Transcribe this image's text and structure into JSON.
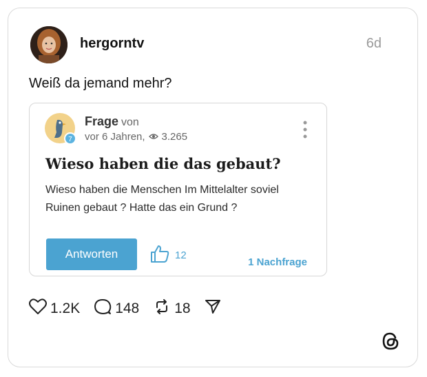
{
  "post": {
    "username": "hergorntv",
    "time": "6d",
    "text": "Weiß da jemand mehr?"
  },
  "embed": {
    "title": "Frage",
    "von": "von",
    "meta_time": "vor 6 Jahren,",
    "views": "3.265",
    "badge": "7",
    "heading": "Wieso haben die das gebaut?",
    "body": "Wieso haben die Menschen Im Mittelalter soviel Ruinen gebaut ? Hatte das ein Grund ?",
    "answer_label": "Antworten",
    "likes": "12",
    "followup": "1 Nachfrage"
  },
  "actions": {
    "likes": "1.2K",
    "comments": "148",
    "reposts": "18"
  },
  "icons": [
    "heart-icon",
    "comment-icon",
    "repost-icon",
    "share-icon",
    "threads-icon",
    "eye-icon",
    "thumbs-up-icon",
    "kebab-icon"
  ],
  "colors": {
    "accent": "#4ba3d1",
    "muted": "#999999"
  }
}
